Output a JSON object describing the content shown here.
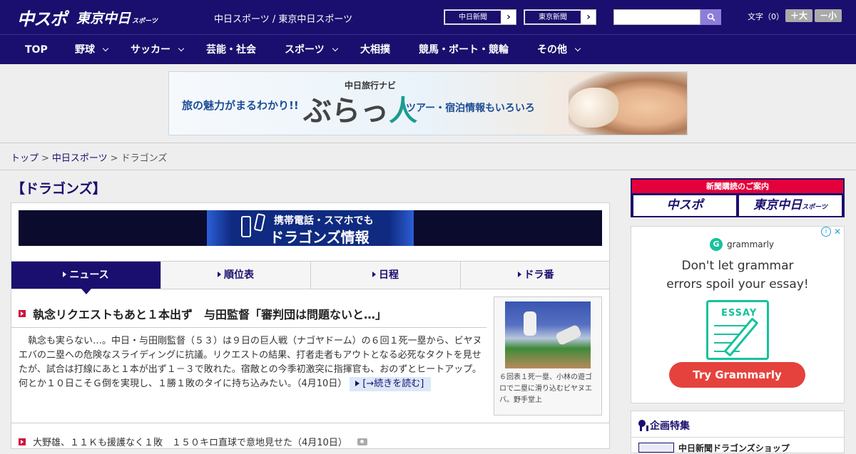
{
  "header": {
    "logo_chuspo": "中スポ",
    "logo_tokyo": "東京中日",
    "logo_tokyo_small": "スポーツ",
    "site_title": "中日スポーツ / 東京中日スポーツ",
    "ext_link_1": "中日新聞",
    "ext_link_2": "東京新聞",
    "search_placeholder": "",
    "font_size_label": "文字（0）",
    "font_larger": "＋大",
    "font_smaller": "－小",
    "brand_color": "#1a0f6e"
  },
  "nav": {
    "items": [
      {
        "label": "TOP",
        "has_dropdown": false
      },
      {
        "label": "野球",
        "has_dropdown": true
      },
      {
        "label": "サッカー",
        "has_dropdown": true
      },
      {
        "label": "芸能・社会",
        "has_dropdown": false
      },
      {
        "label": "スポーツ",
        "has_dropdown": true
      },
      {
        "label": "大相撲",
        "has_dropdown": false
      },
      {
        "label": "競馬・ボート・競輪",
        "has_dropdown": false
      },
      {
        "label": "その他",
        "has_dropdown": true
      }
    ]
  },
  "banner": {
    "left_text": "旅の魅力がまるわかり!!",
    "sub_text": "中日旅行ナビ",
    "main_text": "ぶらっ",
    "main_text_accent": "人",
    "right_text": "ツアー・宿泊情報もいろいろ"
  },
  "breadcrumb": {
    "items": [
      "トップ",
      "中日スポーツ",
      "ドラゴンズ"
    ],
    "separator": ">"
  },
  "page": {
    "heading": "【ドラゴンズ】"
  },
  "mobile_banner": {
    "line1": "携帯電話・スマホでも",
    "line2": "ドラゴンズ情報"
  },
  "tabs": [
    {
      "label": "ニュース",
      "active": true
    },
    {
      "label": "順位表",
      "active": false
    },
    {
      "label": "日程",
      "active": false
    },
    {
      "label": "ドラ番",
      "active": false
    }
  ],
  "article": {
    "title": "執念リクエストもあと１本出ず　与田監督「審判団は問題ないと…」",
    "body": "　執念も実らない…。中日・与田剛監督（５３）は９日の巨人戦（ナゴヤドーム）の６回１死一塁から、ビヤヌエバの二塁への危険なスライディングに抗議。リクエストの結果、打者走者もアウトとなる必死なタクトを見せたが、試合は打線にあと１本が出ず１－３で敗れた。宿敵との今季初激突に指揮官も、おのずとヒートアップ。何とか１０日こそＧ倒を実現し、１勝１敗のタイに持ち込みたい。（4月10日）",
    "read_more": "[→続きを読む]",
    "photo_caption": "６回表１死一塁、小林の遊ゴロで二塁に滑り込むビヤヌエバ。野手堂上"
  },
  "article2": {
    "title": "大野雄、１１Ｋも援護なく１敗　１５０キロ直球で意地見せた（4月10日）"
  },
  "sidebar": {
    "subscribe_head": "新聞購読のご案内",
    "subscribe_btn1": "中スポ",
    "subscribe_btn2": "東京中日",
    "subscribe_btn2_small": "スポーツ",
    "ad_info": "i",
    "ad_close": "✕",
    "ad_brand": "grammarly",
    "ad_brand_mark": "G",
    "ad_headline_1": "Don't let grammar",
    "ad_headline_2": "errors spoil your essay!",
    "ad_essay_label": "ESSAY",
    "ad_cta": "Try Grammarly",
    "feature_title": "企画特集",
    "feature_item": "中日新聞ドラゴンズショップ"
  }
}
